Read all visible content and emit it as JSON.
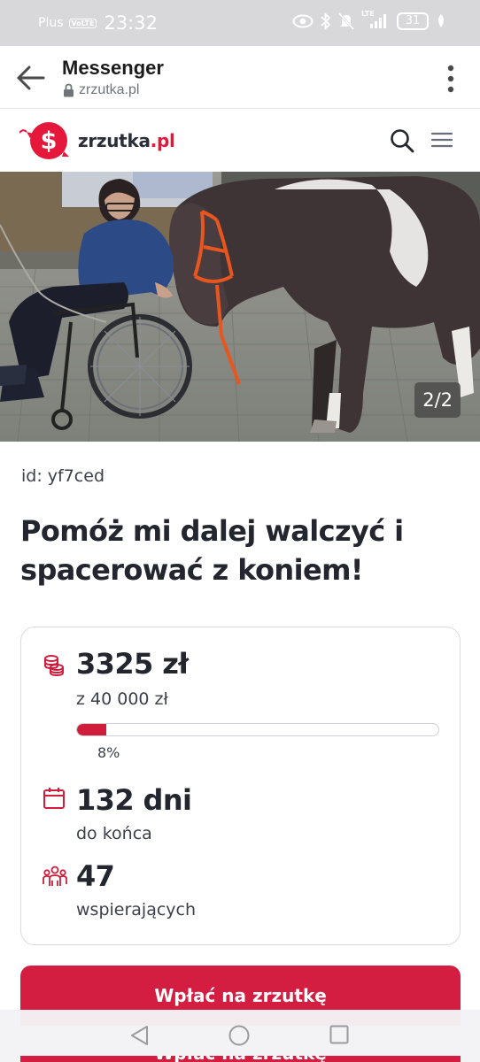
{
  "status_bar": {
    "carrier": "Plus",
    "volte": "VoLTE",
    "time": "23:32",
    "network": "LTE",
    "battery": "31"
  },
  "browser": {
    "app_title": "Messenger",
    "url": "zrzutka.pl"
  },
  "site": {
    "logo_text_main": "zrzutka",
    "logo_text_accent": ".pl",
    "brand_color": "#e5183c"
  },
  "gallery": {
    "counter": "2/2"
  },
  "campaign": {
    "id_label": "id: yf7ced",
    "title": "Pomóż mi dalej walczyć i spacerować z koniem!"
  },
  "stats": {
    "raised": "3325 zł",
    "goal": "z 40 000 zł",
    "progress_percent": 8,
    "progress_label": "8%",
    "days": "132 dni",
    "days_label": "do końca",
    "supporters": "47",
    "supporters_label": "wspierających"
  },
  "actions": {
    "donate_label": "Wpłać na zrzutkę"
  }
}
